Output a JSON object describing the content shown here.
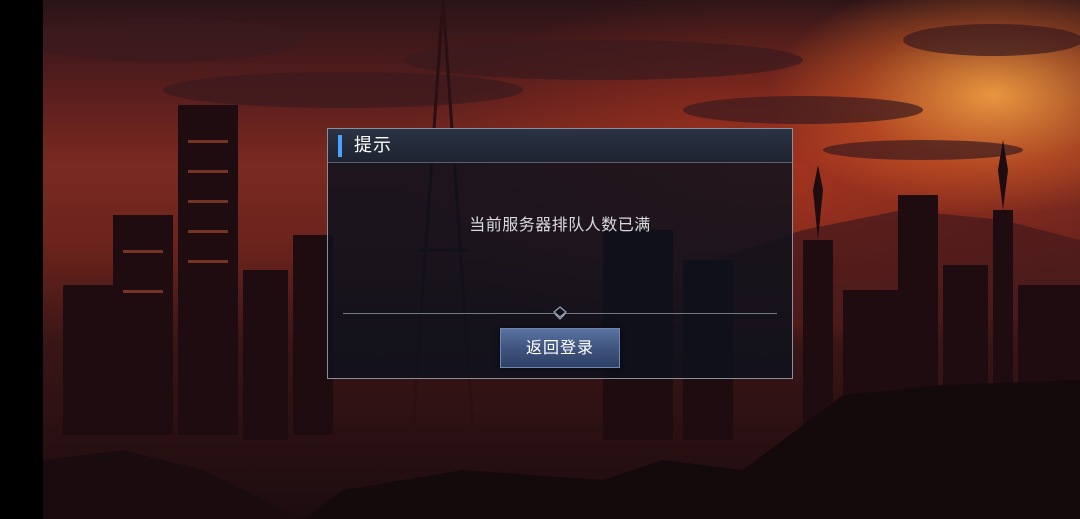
{
  "dialog": {
    "title": "提示",
    "message": "当前服务器排队人数已满",
    "button_label": "返回登录"
  },
  "colors": {
    "header_accent": "#4aa3ff",
    "button_top": "#5a73a1",
    "button_bottom": "#2f4166",
    "sky_glow": "#ffaa46"
  },
  "icons": {
    "divider_ornament": "diamond-chevron-icon"
  }
}
